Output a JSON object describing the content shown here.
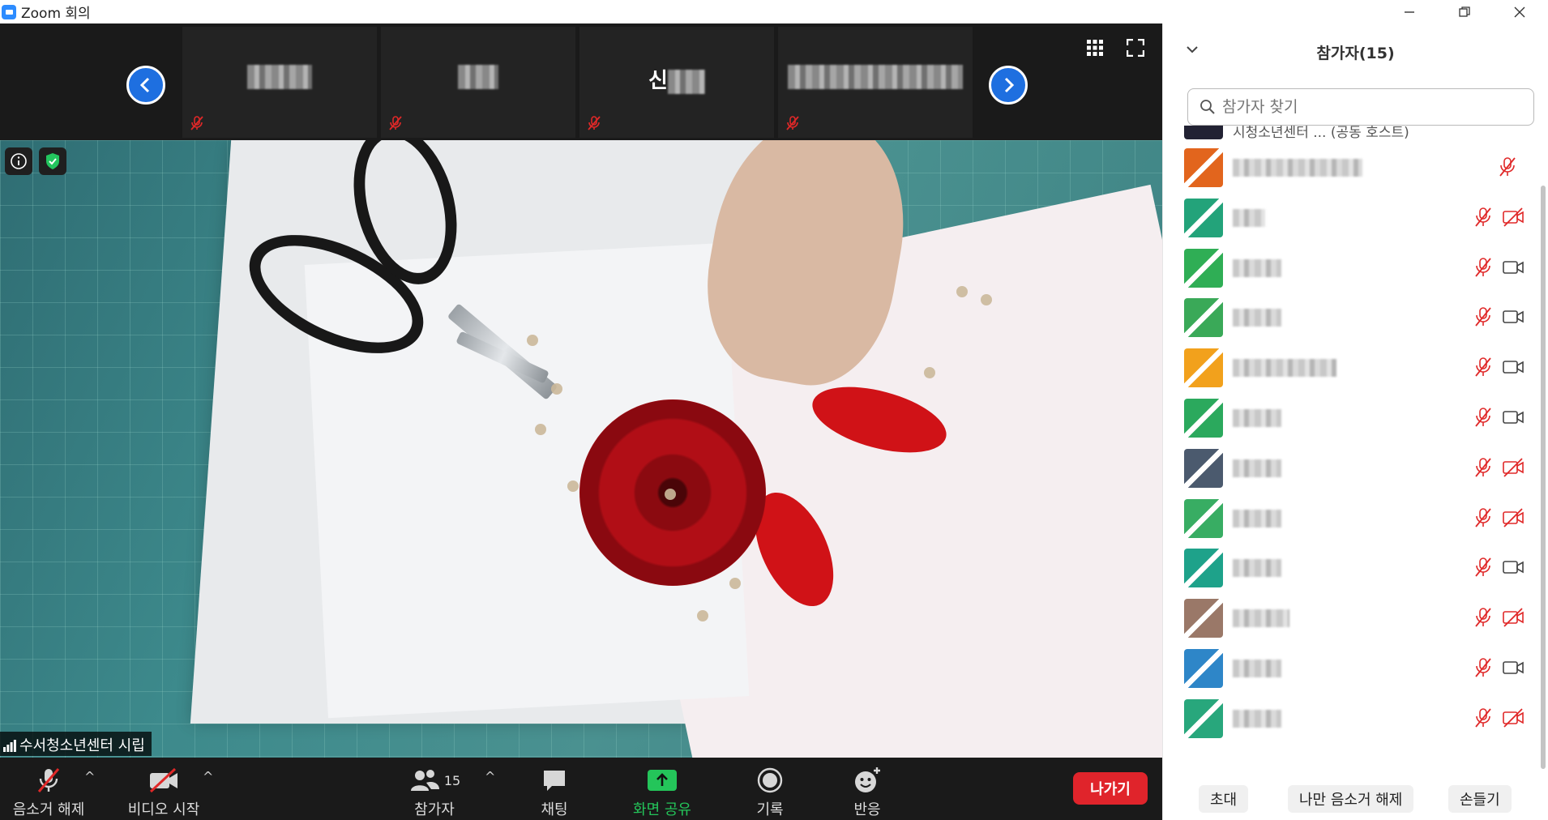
{
  "window": {
    "title": "Zoom 회의"
  },
  "strip": {
    "thumbs": [
      {
        "name": ""
      },
      {
        "name": ""
      },
      {
        "name": "신"
      },
      {
        "name": ""
      }
    ]
  },
  "speaker": {
    "label": "수서청소년센터 시립"
  },
  "toolbar": {
    "mute_label": "음소거 해제",
    "video_label": "비디오 시작",
    "participants_label": "참가자",
    "participants_count": "15",
    "chat_label": "채팅",
    "share_label": "화면 공유",
    "record_label": "기록",
    "reactions_label": "반응",
    "leave_label": "나가기"
  },
  "panel": {
    "title": "참가자(15)",
    "search_placeholder": "참가자 찾기",
    "partial_top_text": "시청소년센터 ... (공동 호스트)",
    "participants": [
      {
        "avatar_color": "#e2651d",
        "video": "none"
      },
      {
        "avatar_color": "#23a37a",
        "video": "off"
      },
      {
        "avatar_color": "#2fae55",
        "video": "on"
      },
      {
        "avatar_color": "#3aa958",
        "video": "on"
      },
      {
        "avatar_color": "#f2a11c",
        "video": "on"
      },
      {
        "avatar_color": "#2ba95d",
        "video": "on"
      },
      {
        "avatar_color": "#4b5a6e",
        "video": "off"
      },
      {
        "avatar_color": "#38ad63",
        "video": "off"
      },
      {
        "avatar_color": "#1ea28a",
        "video": "on"
      },
      {
        "avatar_color": "#9a7868",
        "video": "off"
      },
      {
        "avatar_color": "#2e86c8",
        "video": "on"
      },
      {
        "avatar_color": "#28a77c",
        "video": "off"
      }
    ],
    "invite_label": "초대",
    "unmute_me_label": "나만 음소거 해제",
    "raise_hand_label": "손들기"
  },
  "colors": {
    "accent": "#2d8cff",
    "leave": "#e0242b",
    "share": "#24c55a",
    "muted": "#e02828"
  }
}
